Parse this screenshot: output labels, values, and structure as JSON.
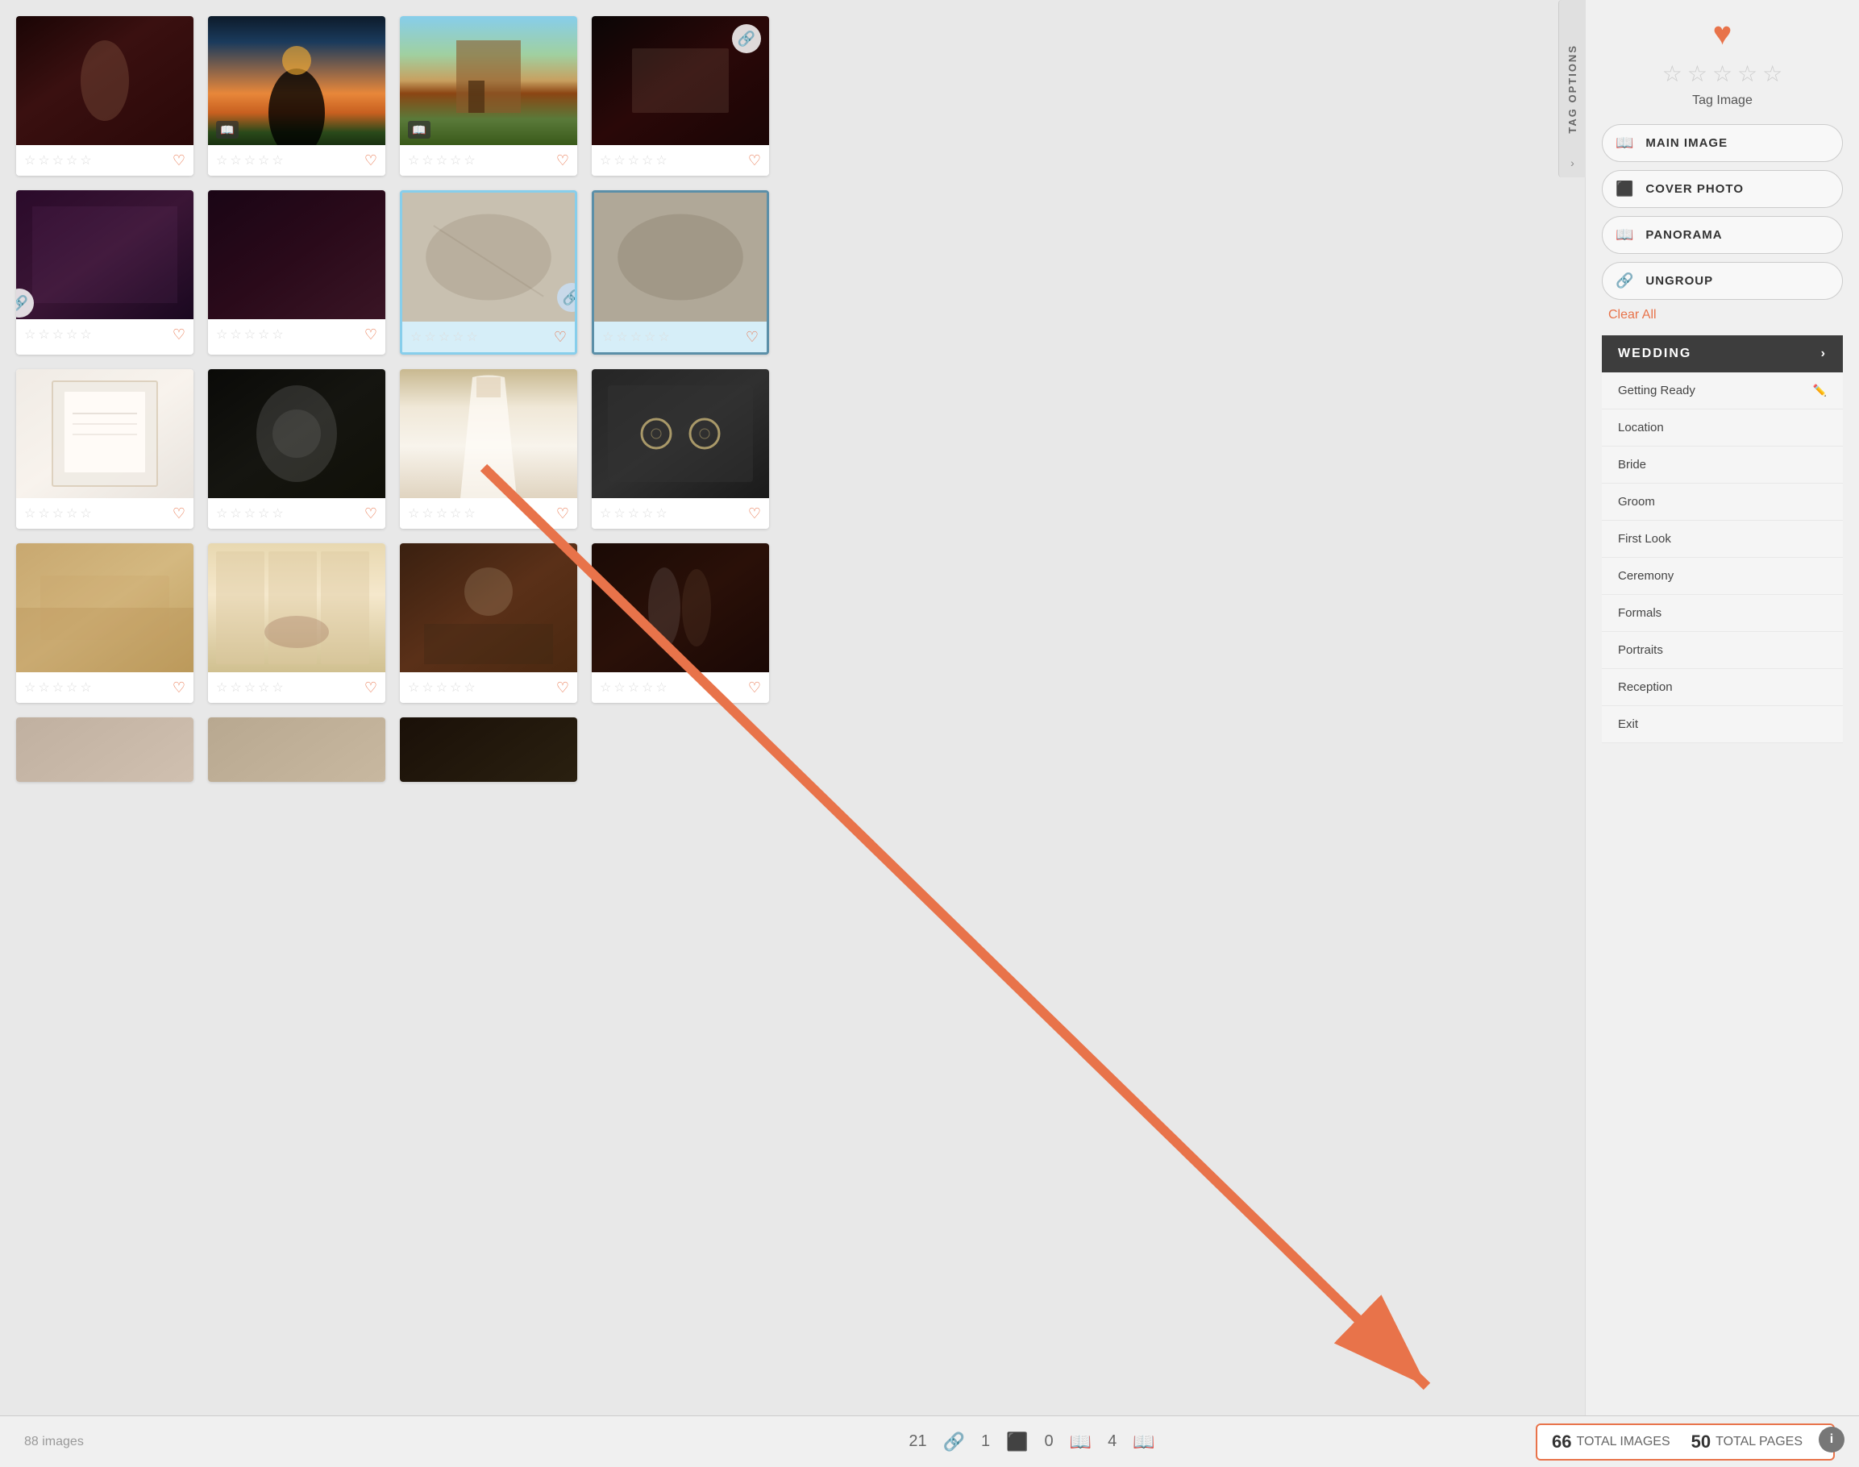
{
  "sidebar": {
    "tag_options_label": "TAG OPTIONS",
    "chevron": "›",
    "heart_icon": "♥",
    "stars": [
      "☆",
      "☆",
      "☆",
      "☆",
      "☆"
    ],
    "tag_image_label": "Tag Image",
    "tag_buttons": [
      {
        "id": "main-image",
        "label": "MAIN IMAGE",
        "icon": "📖"
      },
      {
        "id": "cover-photo",
        "label": "COVER PHOTO",
        "icon": "⬛"
      },
      {
        "id": "panorama",
        "label": "PANORAMA",
        "icon": "📖"
      },
      {
        "id": "ungroup",
        "label": "UNGROUP",
        "icon": "🔗"
      }
    ],
    "clear_all_label": "Clear All",
    "wedding_label": "WEDDING",
    "wedding_chevron": "›",
    "wedding_items": [
      {
        "label": "Getting Ready",
        "editable": true
      },
      {
        "label": "Location",
        "editable": false
      },
      {
        "label": "Bride",
        "editable": false
      },
      {
        "label": "Groom",
        "editable": false
      },
      {
        "label": "First Look",
        "editable": false
      },
      {
        "label": "Ceremony",
        "editable": false
      },
      {
        "label": "Formals",
        "editable": false
      },
      {
        "label": "Portraits",
        "editable": false
      },
      {
        "label": "Reception",
        "editable": false
      },
      {
        "label": "Exit",
        "editable": false
      }
    ]
  },
  "status_bar": {
    "images_label": "88 images",
    "linked_count": "21",
    "link_icon": "🔗",
    "number1": "1",
    "square_icon": "⬛",
    "number2": "0",
    "book_icon": "📖",
    "number3": "4",
    "book_icon2": "📖",
    "total_images_count": "66",
    "total_images_label": "TOTAL IMAGES",
    "total_pages_count": "50",
    "total_pages_label": "TOTAL PAGES"
  },
  "info_icon": "i",
  "photos": [
    {
      "id": 1,
      "scene": "scene-dance",
      "has_link_left": false,
      "has_link_right": false,
      "has_book": false,
      "selected": false
    },
    {
      "id": 2,
      "scene": "scene-sunset",
      "has_link_left": false,
      "has_link_right": false,
      "has_book": true,
      "selected": false
    },
    {
      "id": 3,
      "scene": "scene-building",
      "has_link_left": false,
      "has_link_right": false,
      "has_book": true,
      "selected": false
    },
    {
      "id": 4,
      "scene": "scene-reception1",
      "has_link_left": false,
      "has_link_right": true,
      "has_book": false,
      "selected": false
    },
    {
      "id": 5,
      "scene": "scene-ceremony",
      "has_link_left": true,
      "has_link_right": false,
      "has_book": false,
      "selected": false
    },
    {
      "id": 6,
      "scene": "scene-party",
      "has_link_left": false,
      "has_link_right": false,
      "has_book": false,
      "selected": false
    },
    {
      "id": 7,
      "scene": "scene-vintage1",
      "has_link_left": false,
      "has_link_right": true,
      "has_book": false,
      "selected": true,
      "selection_type": "blue"
    },
    {
      "id": 8,
      "scene": "scene-vintage2",
      "has_link_left": false,
      "has_link_right": false,
      "has_book": false,
      "selected": true,
      "selection_type": "dark"
    },
    {
      "id": 9,
      "scene": "scene-invitation",
      "has_link_left": false,
      "has_link_right": false,
      "has_book": false,
      "selected": false
    },
    {
      "id": 10,
      "scene": "scene-flowers",
      "has_link_left": false,
      "has_link_right": false,
      "has_book": false,
      "selected": false
    },
    {
      "id": 11,
      "scene": "scene-dress",
      "has_link_left": false,
      "has_link_right": false,
      "has_book": false,
      "selected": false
    },
    {
      "id": 12,
      "scene": "scene-rings",
      "has_link_left": false,
      "has_link_right": false,
      "has_book": false,
      "selected": false
    },
    {
      "id": 13,
      "scene": "scene-outdoor",
      "has_link_left": false,
      "has_link_right": false,
      "has_book": false,
      "selected": false
    },
    {
      "id": 14,
      "scene": "scene-interior",
      "has_link_left": false,
      "has_link_right": false,
      "has_book": false,
      "selected": false
    },
    {
      "id": 15,
      "scene": "scene-reception2",
      "has_link_left": false,
      "has_link_right": false,
      "has_book": false,
      "selected": false
    },
    {
      "id": 16,
      "scene": "scene-couple",
      "has_link_left": false,
      "has_link_right": false,
      "has_book": false,
      "selected": false
    },
    {
      "id": 17,
      "scene": "scene-partial1",
      "has_link_left": false,
      "has_link_right": false,
      "has_book": false,
      "selected": false
    },
    {
      "id": 18,
      "scene": "scene-partial2",
      "has_link_left": false,
      "has_link_right": false,
      "has_book": false,
      "selected": false
    },
    {
      "id": 19,
      "scene": "scene-partial3",
      "has_link_left": false,
      "has_link_right": false,
      "has_book": false,
      "selected": false
    }
  ]
}
